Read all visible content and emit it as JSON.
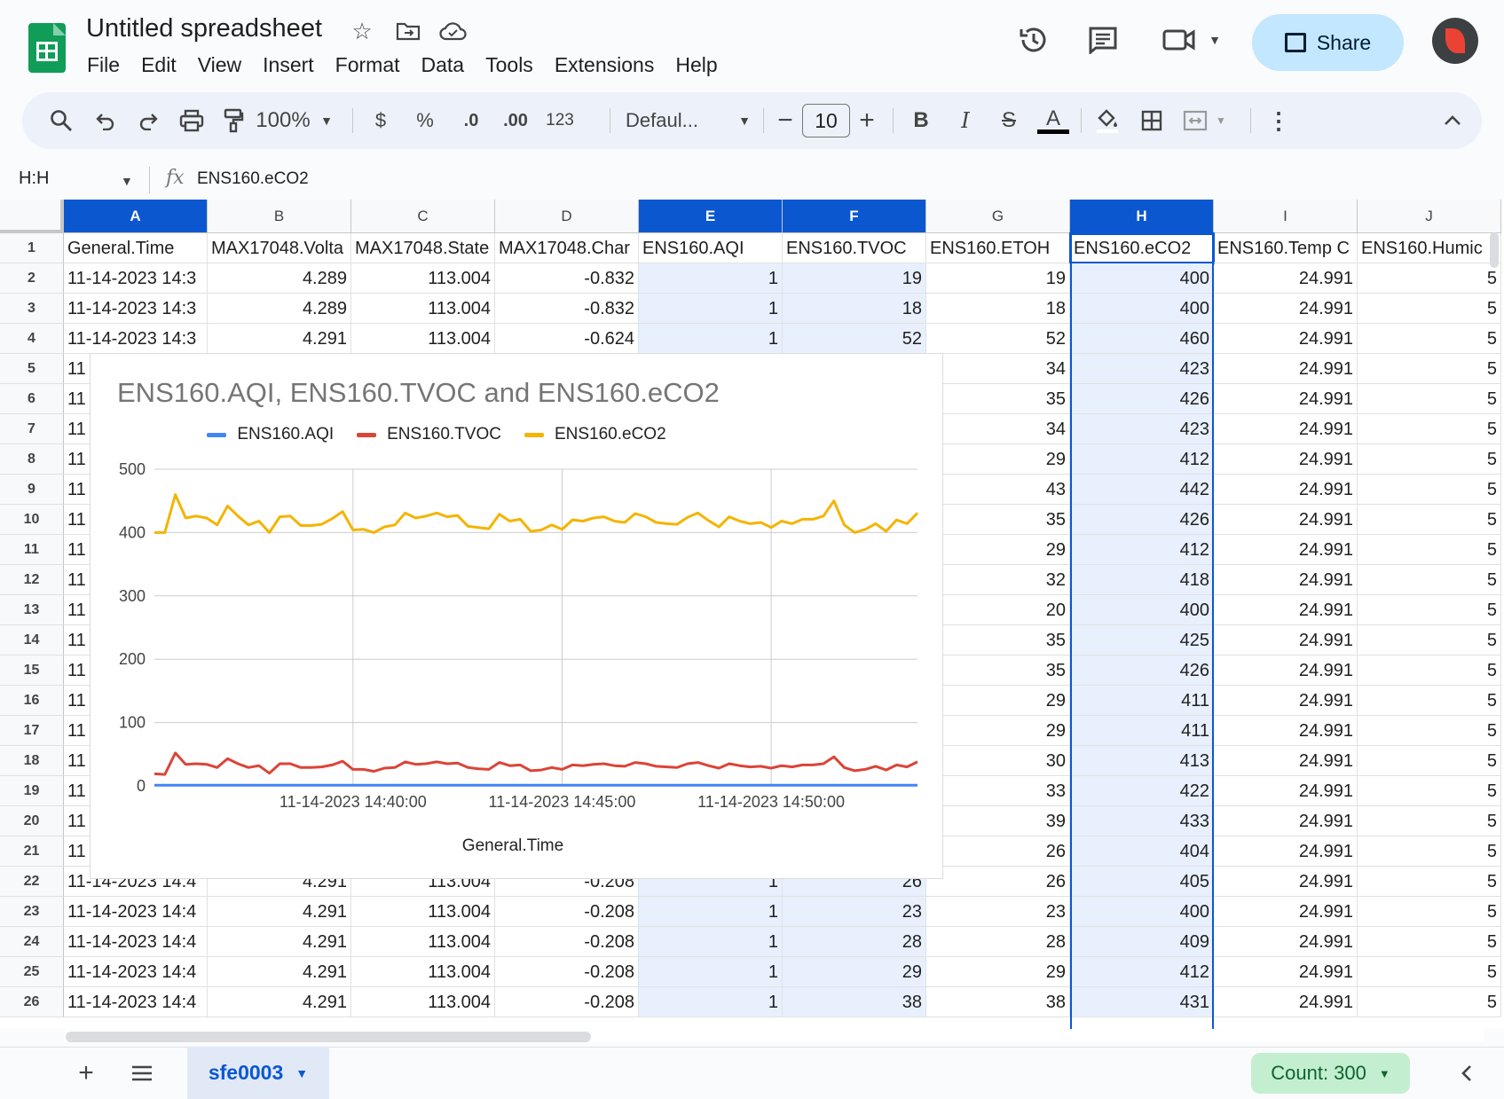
{
  "app": {
    "doc_title": "Untitled spreadsheet",
    "menu": [
      "File",
      "Edit",
      "View",
      "Insert",
      "Format",
      "Data",
      "Tools",
      "Extensions",
      "Help"
    ],
    "share_label": "Share"
  },
  "toolbar": {
    "zoom": "100%",
    "currency": "$",
    "percent": "%",
    "dec_decrease": ".0",
    "dec_increase": ".00",
    "format_123": "123",
    "font": "Defaul...",
    "font_size": "10",
    "bold": "B",
    "italic": "I",
    "strike": "S",
    "text_color": "A"
  },
  "formula_bar": {
    "name_box": "H:H",
    "fx": "fx",
    "content": "ENS160.eCO2"
  },
  "columns": [
    "A",
    "B",
    "C",
    "D",
    "E",
    "F",
    "G",
    "H",
    "I",
    "J"
  ],
  "selected_columns": [
    "A",
    "E",
    "F",
    "H"
  ],
  "rows": [
    {
      "n": "1",
      "cells": [
        "General.Time",
        "MAX17048.Volta",
        "MAX17048.State",
        "MAX17048.Char",
        "ENS160.AQI",
        "ENS160.TVOC",
        "ENS160.ETOH",
        "ENS160.eCO2",
        "ENS160.Temp C",
        "ENS160.Humic"
      ]
    },
    {
      "n": "2",
      "cells": [
        "11-14-2023 14:3",
        "4.289",
        "113.004",
        "-0.832",
        "1",
        "19",
        "19",
        "400",
        "24.991",
        "5"
      ]
    },
    {
      "n": "3",
      "cells": [
        "11-14-2023 14:3",
        "4.289",
        "113.004",
        "-0.832",
        "1",
        "18",
        "18",
        "400",
        "24.991",
        "5"
      ]
    },
    {
      "n": "4",
      "cells": [
        "11-14-2023 14:3",
        "4.291",
        "113.004",
        "-0.624",
        "1",
        "52",
        "52",
        "460",
        "24.991",
        "5"
      ]
    },
    {
      "n": "5",
      "cells": [
        "11",
        "",
        "",
        "",
        "",
        "",
        "34",
        "423",
        "24.991",
        "5"
      ]
    },
    {
      "n": "6",
      "cells": [
        "11",
        "",
        "",
        "",
        "",
        "",
        "35",
        "426",
        "24.991",
        "5"
      ]
    },
    {
      "n": "7",
      "cells": [
        "11",
        "",
        "",
        "",
        "",
        "",
        "34",
        "423",
        "24.991",
        "5"
      ]
    },
    {
      "n": "8",
      "cells": [
        "11",
        "",
        "",
        "",
        "",
        "",
        "29",
        "412",
        "24.991",
        "5"
      ]
    },
    {
      "n": "9",
      "cells": [
        "11",
        "",
        "",
        "",
        "",
        "",
        "43",
        "442",
        "24.991",
        "5"
      ]
    },
    {
      "n": "10",
      "cells": [
        "11",
        "",
        "",
        "",
        "",
        "",
        "35",
        "426",
        "24.991",
        "5"
      ]
    },
    {
      "n": "11",
      "cells": [
        "11",
        "",
        "",
        "",
        "",
        "",
        "29",
        "412",
        "24.991",
        "5"
      ]
    },
    {
      "n": "12",
      "cells": [
        "11",
        "",
        "",
        "",
        "",
        "",
        "32",
        "418",
        "24.991",
        "5"
      ]
    },
    {
      "n": "13",
      "cells": [
        "11",
        "",
        "",
        "",
        "",
        "",
        "20",
        "400",
        "24.991",
        "5"
      ]
    },
    {
      "n": "14",
      "cells": [
        "11",
        "",
        "",
        "",
        "",
        "",
        "35",
        "425",
        "24.991",
        "5"
      ]
    },
    {
      "n": "15",
      "cells": [
        "11",
        "",
        "",
        "",
        "",
        "",
        "35",
        "426",
        "24.991",
        "5"
      ]
    },
    {
      "n": "16",
      "cells": [
        "11",
        "",
        "",
        "",
        "",
        "",
        "29",
        "411",
        "24.991",
        "5"
      ]
    },
    {
      "n": "17",
      "cells": [
        "11",
        "",
        "",
        "",
        "",
        "",
        "29",
        "411",
        "24.991",
        "5"
      ]
    },
    {
      "n": "18",
      "cells": [
        "11",
        "",
        "",
        "",
        "",
        "",
        "30",
        "413",
        "24.991",
        "5"
      ]
    },
    {
      "n": "19",
      "cells": [
        "11",
        "",
        "",
        "",
        "",
        "",
        "33",
        "422",
        "24.991",
        "5"
      ]
    },
    {
      "n": "20",
      "cells": [
        "11",
        "",
        "",
        "",
        "",
        "",
        "39",
        "433",
        "24.991",
        "5"
      ]
    },
    {
      "n": "21",
      "cells": [
        "11",
        "",
        "",
        "",
        "",
        "",
        "26",
        "404",
        "24.991",
        "5"
      ]
    },
    {
      "n": "22",
      "cells": [
        "11-14-2023 14:4",
        "4.291",
        "113.004",
        "-0.208",
        "1",
        "26",
        "26",
        "405",
        "24.991",
        "5"
      ]
    },
    {
      "n": "23",
      "cells": [
        "11-14-2023 14:4",
        "4.291",
        "113.004",
        "-0.208",
        "1",
        "23",
        "23",
        "400",
        "24.991",
        "5"
      ]
    },
    {
      "n": "24",
      "cells": [
        "11-14-2023 14:4",
        "4.291",
        "113.004",
        "-0.208",
        "1",
        "28",
        "28",
        "409",
        "24.991",
        "5"
      ]
    },
    {
      "n": "25",
      "cells": [
        "11-14-2023 14:4",
        "4.291",
        "113.004",
        "-0.208",
        "1",
        "29",
        "29",
        "412",
        "24.991",
        "5"
      ]
    },
    {
      "n": "26",
      "cells": [
        "11-14-2023 14:4",
        "4.291",
        "113.004",
        "-0.208",
        "1",
        "38",
        "38",
        "431",
        "24.991",
        "5"
      ]
    }
  ],
  "chart_data": {
    "type": "line",
    "title": "ENS160.AQI, ENS160.TVOC and ENS160.eCO2",
    "xlabel": "General.Time",
    "ylabel": "",
    "ylim": [
      0,
      500
    ],
    "yticks": [
      "0",
      "100",
      "200",
      "300",
      "400",
      "500"
    ],
    "xticks": [
      "11-14-2023 14:40:00",
      "11-14-2023 14:45:00",
      "11-14-2023 14:50:00"
    ],
    "grid": true,
    "legend": "top",
    "series": [
      {
        "name": "ENS160.AQI",
        "color": "#4285f4",
        "values": [
          1,
          1,
          1,
          1,
          1,
          1,
          1,
          1,
          1,
          1,
          1,
          1,
          1,
          1,
          1,
          1,
          1,
          1,
          1,
          1,
          1,
          1,
          1,
          1,
          1,
          1,
          1,
          1,
          1,
          1,
          1,
          1,
          1,
          1,
          1,
          1,
          1,
          1,
          1,
          1,
          1,
          1,
          1,
          1,
          1,
          1,
          1,
          1,
          1,
          1,
          1,
          1,
          1,
          1,
          1,
          1,
          1,
          1,
          1,
          1,
          1,
          1,
          1,
          1,
          1,
          1,
          1,
          1,
          1,
          1,
          1,
          1,
          1,
          1
        ]
      },
      {
        "name": "ENS160.TVOC",
        "color": "#db4437",
        "values": [
          19,
          18,
          52,
          34,
          35,
          34,
          29,
          43,
          35,
          29,
          32,
          20,
          35,
          35,
          29,
          29,
          30,
          33,
          39,
          26,
          26,
          23,
          28,
          29,
          38,
          34,
          35,
          38,
          35,
          36,
          29,
          27,
          26,
          37,
          32,
          33,
          24,
          25,
          29,
          26,
          33,
          32,
          34,
          35,
          32,
          31,
          37,
          35,
          31,
          30,
          29,
          35,
          37,
          32,
          28,
          35,
          32,
          30,
          31,
          28,
          32,
          30,
          33,
          33,
          35,
          46,
          29,
          24,
          26,
          31,
          25,
          33,
          30,
          38
        ]
      },
      {
        "name": "ENS160.eCO2",
        "color": "#f4b400",
        "values": [
          400,
          400,
          460,
          423,
          426,
          423,
          412,
          442,
          426,
          412,
          418,
          400,
          425,
          426,
          411,
          411,
          413,
          422,
          433,
          404,
          405,
          400,
          409,
          412,
          431,
          423,
          426,
          431,
          425,
          427,
          410,
          408,
          406,
          429,
          418,
          421,
          402,
          404,
          412,
          405,
          420,
          418,
          423,
          425,
          418,
          416,
          430,
          425,
          416,
          414,
          413,
          424,
          431,
          419,
          409,
          425,
          418,
          414,
          416,
          408,
          418,
          414,
          421,
          421,
          426,
          450,
          412,
          400,
          405,
          414,
          402,
          420,
          414,
          431
        ]
      }
    ]
  },
  "sheet": {
    "tab_name": "sfe0003",
    "count_label": "Count: 300"
  }
}
